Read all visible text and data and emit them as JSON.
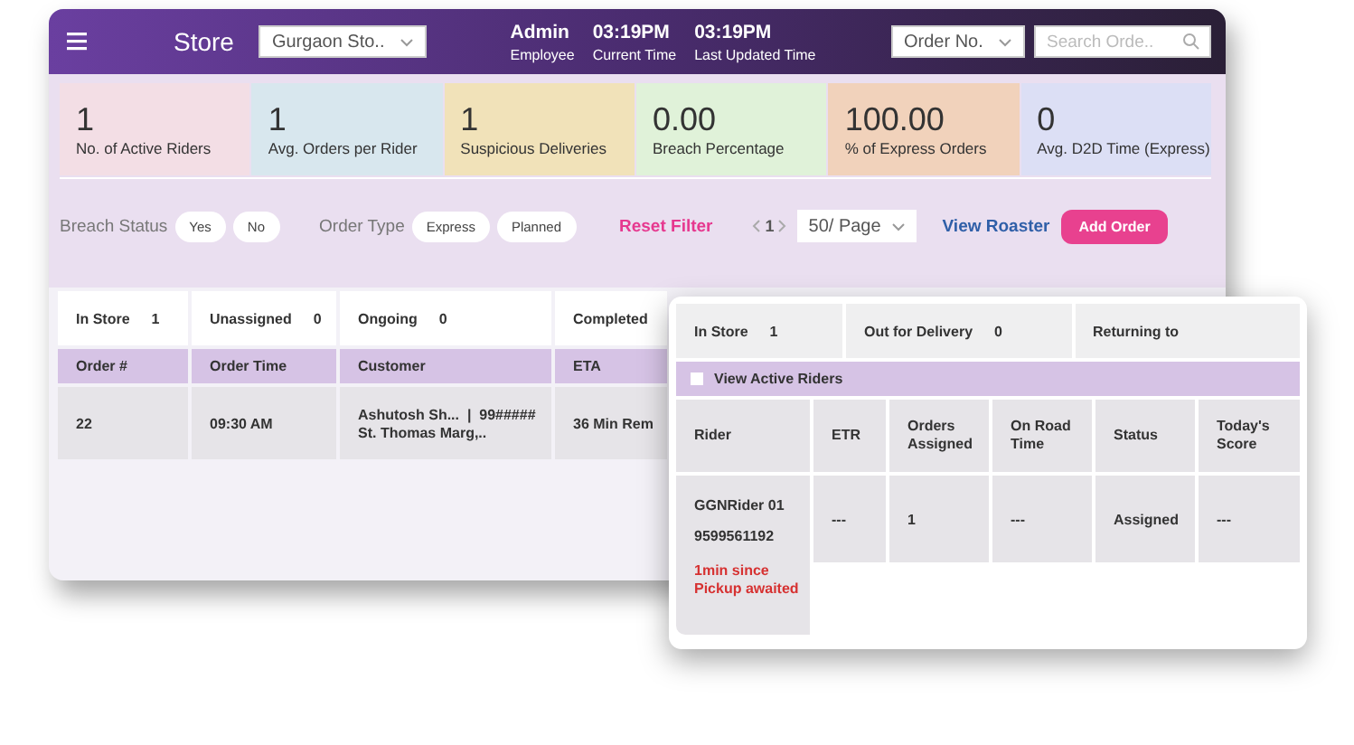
{
  "header": {
    "store_label": "Store",
    "store_select": "Gurgaon Sto..",
    "infos": [
      {
        "value": "Admin",
        "label": "Employee"
      },
      {
        "value": "03:19PM",
        "label": "Current Time"
      },
      {
        "value": "03:19PM",
        "label": "Last Updated Time"
      }
    ],
    "search_type": "Order No.",
    "search": {
      "placeholder": "Search Orde.."
    }
  },
  "stats": [
    {
      "value": "1",
      "label": "No. of Active Riders",
      "color": "#f3dee5"
    },
    {
      "value": "1",
      "label": "Avg. Orders per Rider",
      "color": "#d8e7ee"
    },
    {
      "value": "1",
      "label": "Suspicious Deliveries",
      "color": "#f1e2b9"
    },
    {
      "value": "0.00",
      "label": "Breach Percentage",
      "color": "#e0f2d9"
    },
    {
      "value": "100.00",
      "label": "% of Express Orders",
      "color": "#f1d2bb"
    },
    {
      "value": "0",
      "label": "Avg. D2D Time (Express)",
      "color": "#dcdff5"
    }
  ],
  "filters": {
    "groups": [
      {
        "label": "Breach Status",
        "options": [
          "Yes",
          "No"
        ]
      },
      {
        "label": "Order Type",
        "options": [
          "Express",
          "Planned"
        ]
      }
    ],
    "reset": "Reset Filter",
    "page": "1",
    "page_size": "50/ Page",
    "view_roaster": "View Roaster",
    "add_order": "Add Order"
  },
  "order_tabs": [
    {
      "label": "In Store",
      "count": "1"
    },
    {
      "label": "Unassigned",
      "count": "0"
    },
    {
      "label": "Ongoing",
      "count": "0"
    },
    {
      "label": "Completed"
    }
  ],
  "orders_table": {
    "columns": [
      "Order #",
      "Order Time",
      "Customer",
      "ETA"
    ],
    "rows": [
      {
        "order": "22",
        "time": "09:30 AM",
        "customer_line": "Ashutosh Sh...  |  99#####",
        "customer_address": "St. Thomas Marg,..",
        "eta": "36 Min Rem"
      }
    ]
  },
  "rider_panel": {
    "tabs": [
      {
        "label": "In Store",
        "count": "1"
      },
      {
        "label": "Out for Delivery",
        "count": "0"
      },
      {
        "label": "Returning to"
      }
    ],
    "view_active": {
      "label": "View Active Riders",
      "checked": false
    },
    "columns": [
      "Rider",
      "ETR",
      "Orders Assigned",
      "On Road Time",
      "Status",
      "Today's Score"
    ],
    "rows": [
      {
        "rider": "GGNRider 01",
        "phone": "9599561192",
        "alert": "1min since Pickup awaited",
        "etr": "---",
        "orders": "1",
        "on_road": "---",
        "status": "Assigned",
        "score": "---"
      }
    ]
  }
}
